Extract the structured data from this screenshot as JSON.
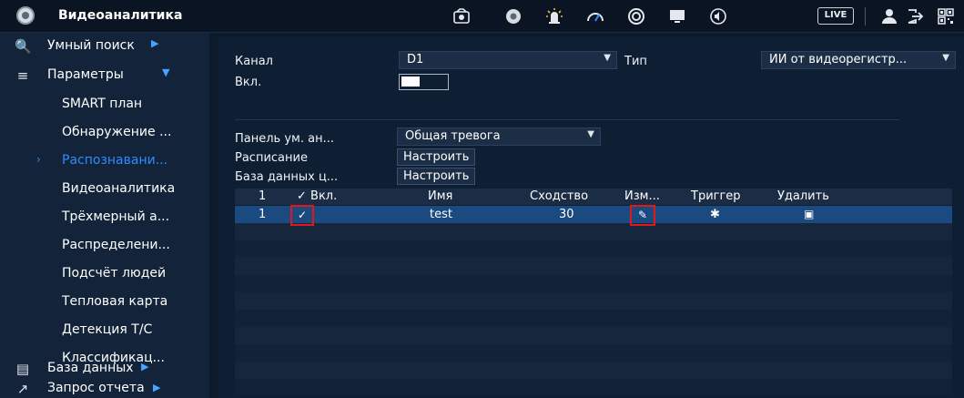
{
  "header": {
    "title": "Видеоаналитика",
    "live_label": "LIVE",
    "icons": [
      "brand-eye-icon",
      "camera-icon",
      "eye-icon",
      "alarm-icon",
      "performance-icon",
      "circle-icon",
      "monitor-icon",
      "volume-icon",
      "user-icon",
      "logout-icon",
      "qr-icon"
    ]
  },
  "sidebar": {
    "items": [
      {
        "label": "Умный поиск",
        "icon": "search-icon"
      },
      {
        "label": "Параметры",
        "icon": "list-icon"
      },
      {
        "label": "SMART план"
      },
      {
        "label": "Обнаружение ..."
      },
      {
        "label": "Распознавани..."
      },
      {
        "label": "Видеоаналитика"
      },
      {
        "label": "Трёхмерный а..."
      },
      {
        "label": "Распределени..."
      },
      {
        "label": "Подсчёт людей"
      },
      {
        "label": "Тепловая карта"
      },
      {
        "label": "Детекция Т/С"
      },
      {
        "label": "Классификац..."
      },
      {
        "label": "База данных",
        "icon": "database-icon"
      },
      {
        "label": "Запрос отчета",
        "icon": "chart-icon"
      }
    ],
    "active_index": 4
  },
  "form": {
    "channel_label": "Канал",
    "channel_value": "D1",
    "type_label": "Тип",
    "type_value": "ИИ от видеорегистр...",
    "enable_label": "Вкл.",
    "panel_label": "Панель ум. ан...",
    "panel_value": "Общая тревога",
    "schedule_label": "Расписание",
    "schedule_btn": "Настроить",
    "db_label": "База данных ц...",
    "db_btn": "Настроить"
  },
  "table": {
    "headers": [
      "1",
      "✓ Вкл.",
      "Имя",
      "Сходство",
      "Изм...",
      "Триггер",
      "Удалить"
    ],
    "rows": [
      {
        "num": "1",
        "enabled": true,
        "name": "test",
        "similarity": "30"
      }
    ]
  },
  "colors": {
    "accent": "#2f8bff",
    "highlight": "#e01818",
    "selected_row": "#1a4a80"
  }
}
